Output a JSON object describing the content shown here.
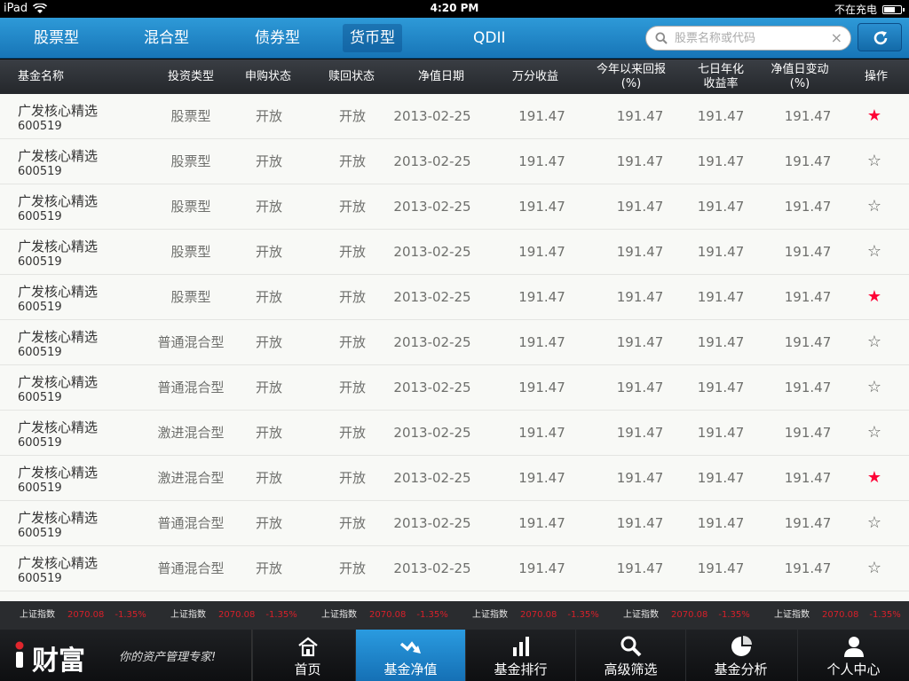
{
  "status_bar": {
    "device": "iPad",
    "time": "4:20 PM",
    "charging_text": "不在充电"
  },
  "categories": [
    "股票型",
    "混合型",
    "债券型",
    "货币型",
    "QDII"
  ],
  "search": {
    "placeholder": "股票名称或代码",
    "clear_symbol": "×"
  },
  "columns": {
    "name": "基金名称",
    "type": "投资类型",
    "subscribe": "申购状态",
    "redeem": "赎回状态",
    "date": "净值日期",
    "income": "万分收益",
    "ytd_l1": "今年以来回报",
    "ytd_l2": "(%)",
    "week_l1": "七日年化",
    "week_l2": "收益率",
    "change_l1": "净值日变动",
    "change_l2": "(%)",
    "action": "操作"
  },
  "rows": [
    {
      "name": "广发核心精选",
      "code": "600519",
      "type": "股票型",
      "subscribe": "开放",
      "redeem": "开放",
      "date": "2013-02-25",
      "income": "191.47",
      "ytd": "191.47",
      "week": "191.47",
      "change": "191.47",
      "star": "★",
      "starred": true
    },
    {
      "name": "广发核心精选",
      "code": "600519",
      "type": "股票型",
      "subscribe": "开放",
      "redeem": "开放",
      "date": "2013-02-25",
      "income": "191.47",
      "ytd": "191.47",
      "week": "191.47",
      "change": "191.47",
      "star": "☆",
      "starred": false
    },
    {
      "name": "广发核心精选",
      "code": "600519",
      "type": "股票型",
      "subscribe": "开放",
      "redeem": "开放",
      "date": "2013-02-25",
      "income": "191.47",
      "ytd": "191.47",
      "week": "191.47",
      "change": "191.47",
      "star": "☆",
      "starred": false
    },
    {
      "name": "广发核心精选",
      "code": "600519",
      "type": "股票型",
      "subscribe": "开放",
      "redeem": "开放",
      "date": "2013-02-25",
      "income": "191.47",
      "ytd": "191.47",
      "week": "191.47",
      "change": "191.47",
      "star": "☆",
      "starred": false
    },
    {
      "name": "广发核心精选",
      "code": "600519",
      "type": "股票型",
      "subscribe": "开放",
      "redeem": "开放",
      "date": "2013-02-25",
      "income": "191.47",
      "ytd": "191.47",
      "week": "191.47",
      "change": "191.47",
      "star": "★",
      "starred": true
    },
    {
      "name": "广发核心精选",
      "code": "600519",
      "type": "普通混合型",
      "subscribe": "开放",
      "redeem": "开放",
      "date": "2013-02-25",
      "income": "191.47",
      "ytd": "191.47",
      "week": "191.47",
      "change": "191.47",
      "star": "☆",
      "starred": false
    },
    {
      "name": "广发核心精选",
      "code": "600519",
      "type": "普通混合型",
      "subscribe": "开放",
      "redeem": "开放",
      "date": "2013-02-25",
      "income": "191.47",
      "ytd": "191.47",
      "week": "191.47",
      "change": "191.47",
      "star": "☆",
      "starred": false
    },
    {
      "name": "广发核心精选",
      "code": "600519",
      "type": "激进混合型",
      "subscribe": "开放",
      "redeem": "开放",
      "date": "2013-02-25",
      "income": "191.47",
      "ytd": "191.47",
      "week": "191.47",
      "change": "191.47",
      "star": "☆",
      "starred": false
    },
    {
      "name": "广发核心精选",
      "code": "600519",
      "type": "激进混合型",
      "subscribe": "开放",
      "redeem": "开放",
      "date": "2013-02-25",
      "income": "191.47",
      "ytd": "191.47",
      "week": "191.47",
      "change": "191.47",
      "star": "★",
      "starred": true
    },
    {
      "name": "广发核心精选",
      "code": "600519",
      "type": "普通混合型",
      "subscribe": "开放",
      "redeem": "开放",
      "date": "2013-02-25",
      "income": "191.47",
      "ytd": "191.47",
      "week": "191.47",
      "change": "191.47",
      "star": "☆",
      "starred": false
    },
    {
      "name": "广发核心精选",
      "code": "600519",
      "type": "普通混合型",
      "subscribe": "开放",
      "redeem": "开放",
      "date": "2013-02-25",
      "income": "191.47",
      "ytd": "191.47",
      "week": "191.47",
      "change": "191.47",
      "star": "☆",
      "starred": false
    }
  ],
  "ticker": [
    {
      "name": "上证指数",
      "value": "2070.08",
      "pct": "-1.35%"
    },
    {
      "name": "上证指数",
      "value": "2070.08",
      "pct": "-1.35%"
    },
    {
      "name": "上证指数",
      "value": "2070.08",
      "pct": "-1.35%"
    },
    {
      "name": "上证指数",
      "value": "2070.08",
      "pct": "-1.35%"
    },
    {
      "name": "上证指数",
      "value": "2070.08",
      "pct": "-1.35%"
    },
    {
      "name": "上证指数",
      "value": "2070.08",
      "pct": "-1.35%"
    }
  ],
  "brand": {
    "logo": "财富",
    "slogan": "你的资产管理专家!"
  },
  "tabs": [
    "首页",
    "基金净值",
    "基金排行",
    "高级筛选",
    "基金分析",
    "个人中心"
  ],
  "colors": {
    "list_text": "#333333",
    "list_value": "#6E6F6C",
    "row_bg": "#F8F9F6",
    "header_bg": "#C4C7C7",
    "star_on": "#FE0236",
    "star_off": "#5D5E5B",
    "search_border": "#ABABAB",
    "ticker_text": "#E8E8E8"
  }
}
